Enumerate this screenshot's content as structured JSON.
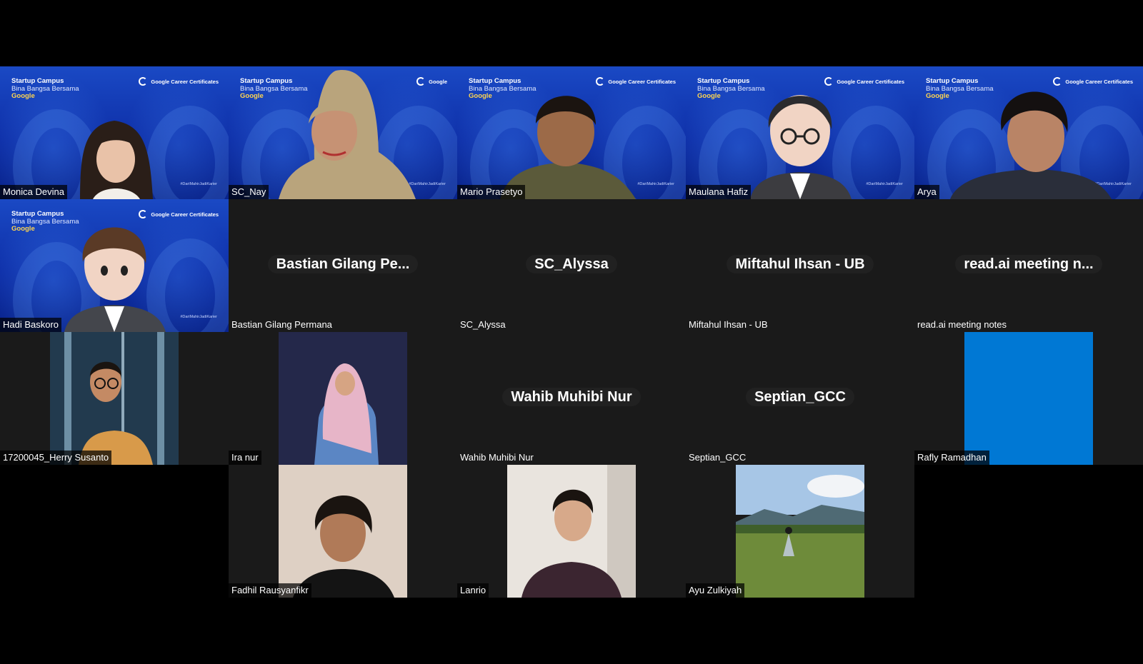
{
  "meeting": {
    "brand": {
      "line1": "Startup Campus",
      "line2": "Bina Bangsa Bersama",
      "line3": "Google",
      "logo": "Google Career Certificates",
      "hashtag": "#DariMahirJadiKarier"
    },
    "participants": [
      {
        "name": "Monica Devina",
        "kind": "video"
      },
      {
        "name": "SC_Nay",
        "kind": "video"
      },
      {
        "name": "Mario Prasetyo",
        "kind": "video"
      },
      {
        "name": "Maulana Hafiz",
        "kind": "avatar"
      },
      {
        "name": "Arya",
        "kind": "video"
      },
      {
        "name": "Hadi Baskoro",
        "kind": "avatar"
      },
      {
        "name": "Bastian Gilang Permana",
        "display": "Bastian Gilang Pe...",
        "kind": "off"
      },
      {
        "name": "SC_Alyssa",
        "display": "SC_Alyssa",
        "kind": "off"
      },
      {
        "name": "Miftahul Ihsan - UB",
        "display": "Miftahul Ihsan - UB",
        "kind": "off"
      },
      {
        "name": "read.ai meeting notes",
        "display": "read.ai meeting n...",
        "kind": "off"
      },
      {
        "name": "17200045_Herry Susanto",
        "kind": "photo"
      },
      {
        "name": "Ira nur",
        "kind": "photo"
      },
      {
        "name": "Wahib Muhibi Nur",
        "display": "Wahib Muhibi Nur",
        "kind": "off"
      },
      {
        "name": "Septian_GCC",
        "display": "Septian_GCC",
        "kind": "off"
      },
      {
        "name": "Rafly Ramadhan",
        "kind": "photo"
      },
      {
        "name": "Fadhil Rausyanfikr",
        "kind": "photo"
      },
      {
        "name": "Lanrio",
        "kind": "photo"
      },
      {
        "name": "Ayu Zulkiyah",
        "kind": "photo"
      }
    ]
  },
  "colors": {
    "brand_blue": "#1a49c4",
    "tile_off": "#1a1a1a",
    "rafly_tile": "#0078d4"
  }
}
